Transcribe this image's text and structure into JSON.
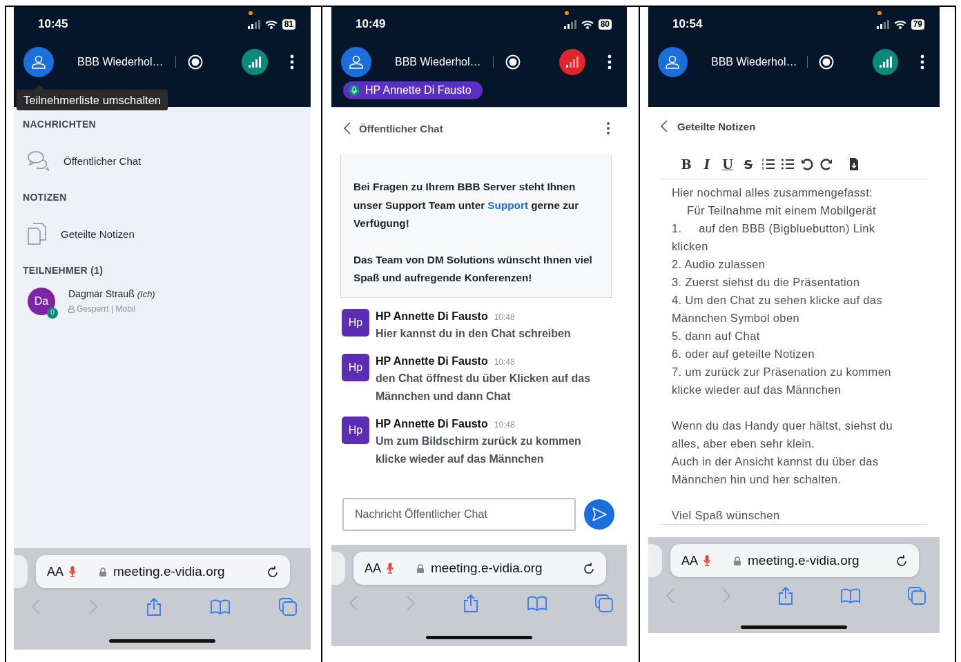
{
  "phones": [
    {
      "kind": "participants",
      "status": {
        "time": "10:45",
        "battery": "81"
      },
      "header": {
        "title": "BBB Wiederhol…",
        "weak_signal": false
      },
      "tooltip": "Teilnehmerliste umschalten",
      "sections": [
        {
          "heading": "NACHRICHTEN",
          "items": [
            {
              "kind": "chat",
              "label": "Öffentlicher Chat"
            }
          ]
        },
        {
          "heading": "NOTIZEN",
          "items": [
            {
              "kind": "notes",
              "label": "Geteilte Notizen"
            }
          ]
        },
        {
          "heading": "TEILNEHMER (1)",
          "items": [
            {
              "kind": "user",
              "initials": "Da",
              "name": "Dagmar Strauß",
              "tag": "(Ich)",
              "status": "Gesperrt | Mobil"
            }
          ]
        }
      ],
      "browser": {
        "text_size": "AA",
        "url": "meeting.e-vidia.org"
      }
    },
    {
      "kind": "chat",
      "status": {
        "time": "10:49",
        "battery": "80"
      },
      "header": {
        "title": "BBB Wiederhol…",
        "weak_signal": true
      },
      "talker": "HP Annette Di Fausto",
      "panel_title": "Öffentlicher Chat",
      "welcome": [
        {
          "text": "Bei Fragen zu Ihrem BBB Server steht Ihnen unser Support Team unter ",
          "link": "Support",
          "after": " gerne zur Verfügung!"
        },
        {
          "text": "Das Team von DM Solutions wünscht Ihnen viel Spaß und aufregende Konferenzen!"
        }
      ],
      "messages": [
        {
          "initials": "Hp",
          "sender": "HP Annette Di Fausto",
          "time": "10:48",
          "text": "Hier kannst du in den Chat schreiben"
        },
        {
          "initials": "Hp",
          "sender": "HP Annette Di Fausto",
          "time": "10:48",
          "text": "den Chat öffnest du über Klicken auf das Männchen und dann Chat"
        },
        {
          "initials": "Hp",
          "sender": "HP Annette Di Fausto",
          "time": "10:48",
          "text": "Um zum Bildschirm zurück zu kommen klicke wieder auf das Männchen"
        }
      ],
      "input": {
        "placeholder": "Nachricht Öffentlicher Chat"
      },
      "browser": {
        "text_size": "AA",
        "url": "meeting.e-vidia.org"
      }
    },
    {
      "kind": "notes",
      "status": {
        "time": "10:54",
        "battery": "79"
      },
      "header": {
        "title": "BBB Wiederhol…",
        "weak_signal": false
      },
      "panel_title": "Geteilte Notizen",
      "toolbar": [
        {
          "kind": "bold",
          "label": "B"
        },
        {
          "kind": "italic",
          "label": "I"
        },
        {
          "kind": "underline",
          "label": "U"
        },
        {
          "kind": "strike",
          "label": "S"
        },
        {
          "kind": "ordered-list"
        },
        {
          "kind": "bullet-list"
        },
        {
          "kind": "undo"
        },
        {
          "kind": "redo"
        },
        {
          "kind": "export"
        }
      ],
      "note": [
        {
          "text": "Hier nochmal alles zusammengefasst:"
        },
        {
          "text": "Für Teilnahme mit einem Mobilgerät",
          "indent": true
        },
        {
          "text": "1.     auf den BBB (Bigbluebutton) Link klicken"
        },
        {
          "text": "2. Audio zulassen"
        },
        {
          "text": "3. Zuerst siehst du die Präsentation"
        },
        {
          "text": "4. Um den Chat zu sehen klicke auf das Männchen Symbol oben"
        },
        {
          "text": "5. dann auf Chat"
        },
        {
          "text": "6. oder auf geteilte Notizen"
        },
        {
          "text": "7. um zurück zur Präsenation zu kommen klicke wieder auf das Männchen"
        },
        {
          "text": "Wenn du das Handy quer hältst, siehst du alles, aber eben sehr klein.",
          "space_before": true
        },
        {
          "text": "Auch in der Ansicht kannst du über das Männchen hin und her schalten."
        },
        {
          "text": "Viel Spaß wünschen",
          "space_before": true
        }
      ],
      "browser": {
        "text_size": "AA",
        "url": "meeting.e-vidia.org"
      }
    }
  ]
}
